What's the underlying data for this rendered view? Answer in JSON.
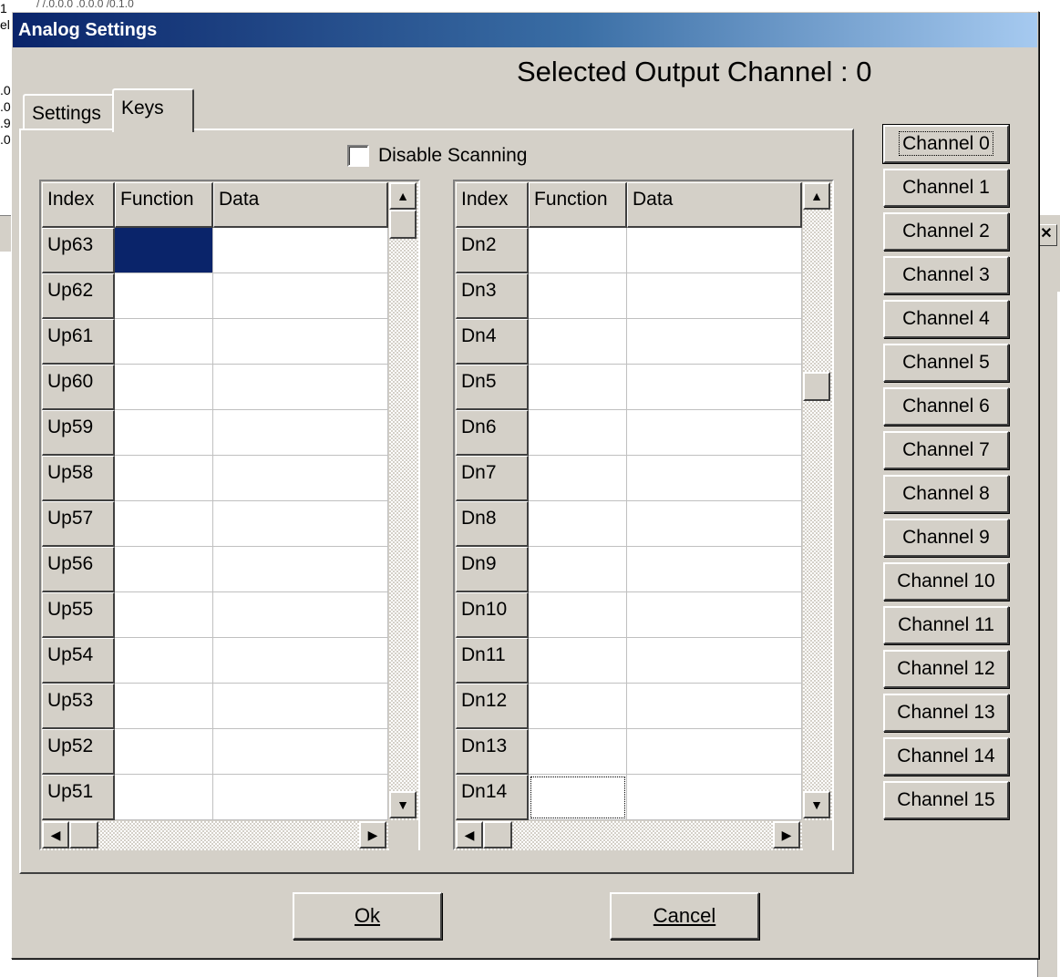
{
  "background": {
    "left_fragment_lines": [
      "1",
      "el",
      "",
      "",
      "",
      ".0",
      ".0",
      ".9",
      ".0"
    ],
    "top_scrawl": "/ /.0.0.0  .0.0.0  /0.1.0",
    "close_glyph": "✕"
  },
  "dialog": {
    "title": "Analog Settings",
    "selected_channel_label": "Selected Output Channel :  0"
  },
  "tabs": [
    {
      "label": "Settings",
      "active": false
    },
    {
      "label": "Keys",
      "active": true
    }
  ],
  "disable_scanning": {
    "label": "Disable Scanning",
    "checked": false
  },
  "grid_columns": [
    "Index",
    "Function",
    "Data"
  ],
  "left_grid": {
    "rows": [
      {
        "index": "Up63",
        "function": "",
        "data": "",
        "selected": true
      },
      {
        "index": "Up62",
        "function": "",
        "data": ""
      },
      {
        "index": "Up61",
        "function": "",
        "data": ""
      },
      {
        "index": "Up60",
        "function": "",
        "data": ""
      },
      {
        "index": "Up59",
        "function": "",
        "data": ""
      },
      {
        "index": "Up58",
        "function": "",
        "data": ""
      },
      {
        "index": "Up57",
        "function": "",
        "data": ""
      },
      {
        "index": "Up56",
        "function": "",
        "data": ""
      },
      {
        "index": "Up55",
        "function": "",
        "data": ""
      },
      {
        "index": "Up54",
        "function": "",
        "data": ""
      },
      {
        "index": "Up53",
        "function": "",
        "data": ""
      },
      {
        "index": "Up52",
        "function": "",
        "data": ""
      },
      {
        "index": "Up51",
        "function": "",
        "data": ""
      }
    ]
  },
  "right_grid": {
    "rows": [
      {
        "index": "Dn2",
        "function": "",
        "data": ""
      },
      {
        "index": "Dn3",
        "function": "",
        "data": ""
      },
      {
        "index": "Dn4",
        "function": "",
        "data": ""
      },
      {
        "index": "Dn5",
        "function": "",
        "data": ""
      },
      {
        "index": "Dn6",
        "function": "",
        "data": ""
      },
      {
        "index": "Dn7",
        "function": "",
        "data": ""
      },
      {
        "index": "Dn8",
        "function": "",
        "data": ""
      },
      {
        "index": "Dn9",
        "function": "",
        "data": ""
      },
      {
        "index": "Dn10",
        "function": "",
        "data": ""
      },
      {
        "index": "Dn11",
        "function": "",
        "data": ""
      },
      {
        "index": "Dn12",
        "function": "",
        "data": ""
      },
      {
        "index": "Dn13",
        "function": "",
        "data": ""
      },
      {
        "index": "Dn14",
        "function": "",
        "data": "",
        "focused": true
      }
    ]
  },
  "scroll": {
    "left_vertical_position": 0.0,
    "right_vertical_position": 0.14,
    "arrows": {
      "up": "▲",
      "down": "▼",
      "left": "◀",
      "right": "▶"
    }
  },
  "channels": [
    "Channel 0",
    "Channel 1",
    "Channel 2",
    "Channel 3",
    "Channel 4",
    "Channel 5",
    "Channel 6",
    "Channel 7",
    "Channel 8",
    "Channel 9",
    "Channel 10",
    "Channel 11",
    "Channel 12",
    "Channel 13",
    "Channel 14",
    "Channel 15"
  ],
  "active_channel": "Channel 0",
  "buttons": {
    "ok_label": "Ok",
    "cancel_label": "Cancel"
  },
  "colors": {
    "title_start": "#0a246a",
    "title_end": "#a6caf0",
    "face": "#d4d0c8",
    "selection": "#0a246a"
  }
}
